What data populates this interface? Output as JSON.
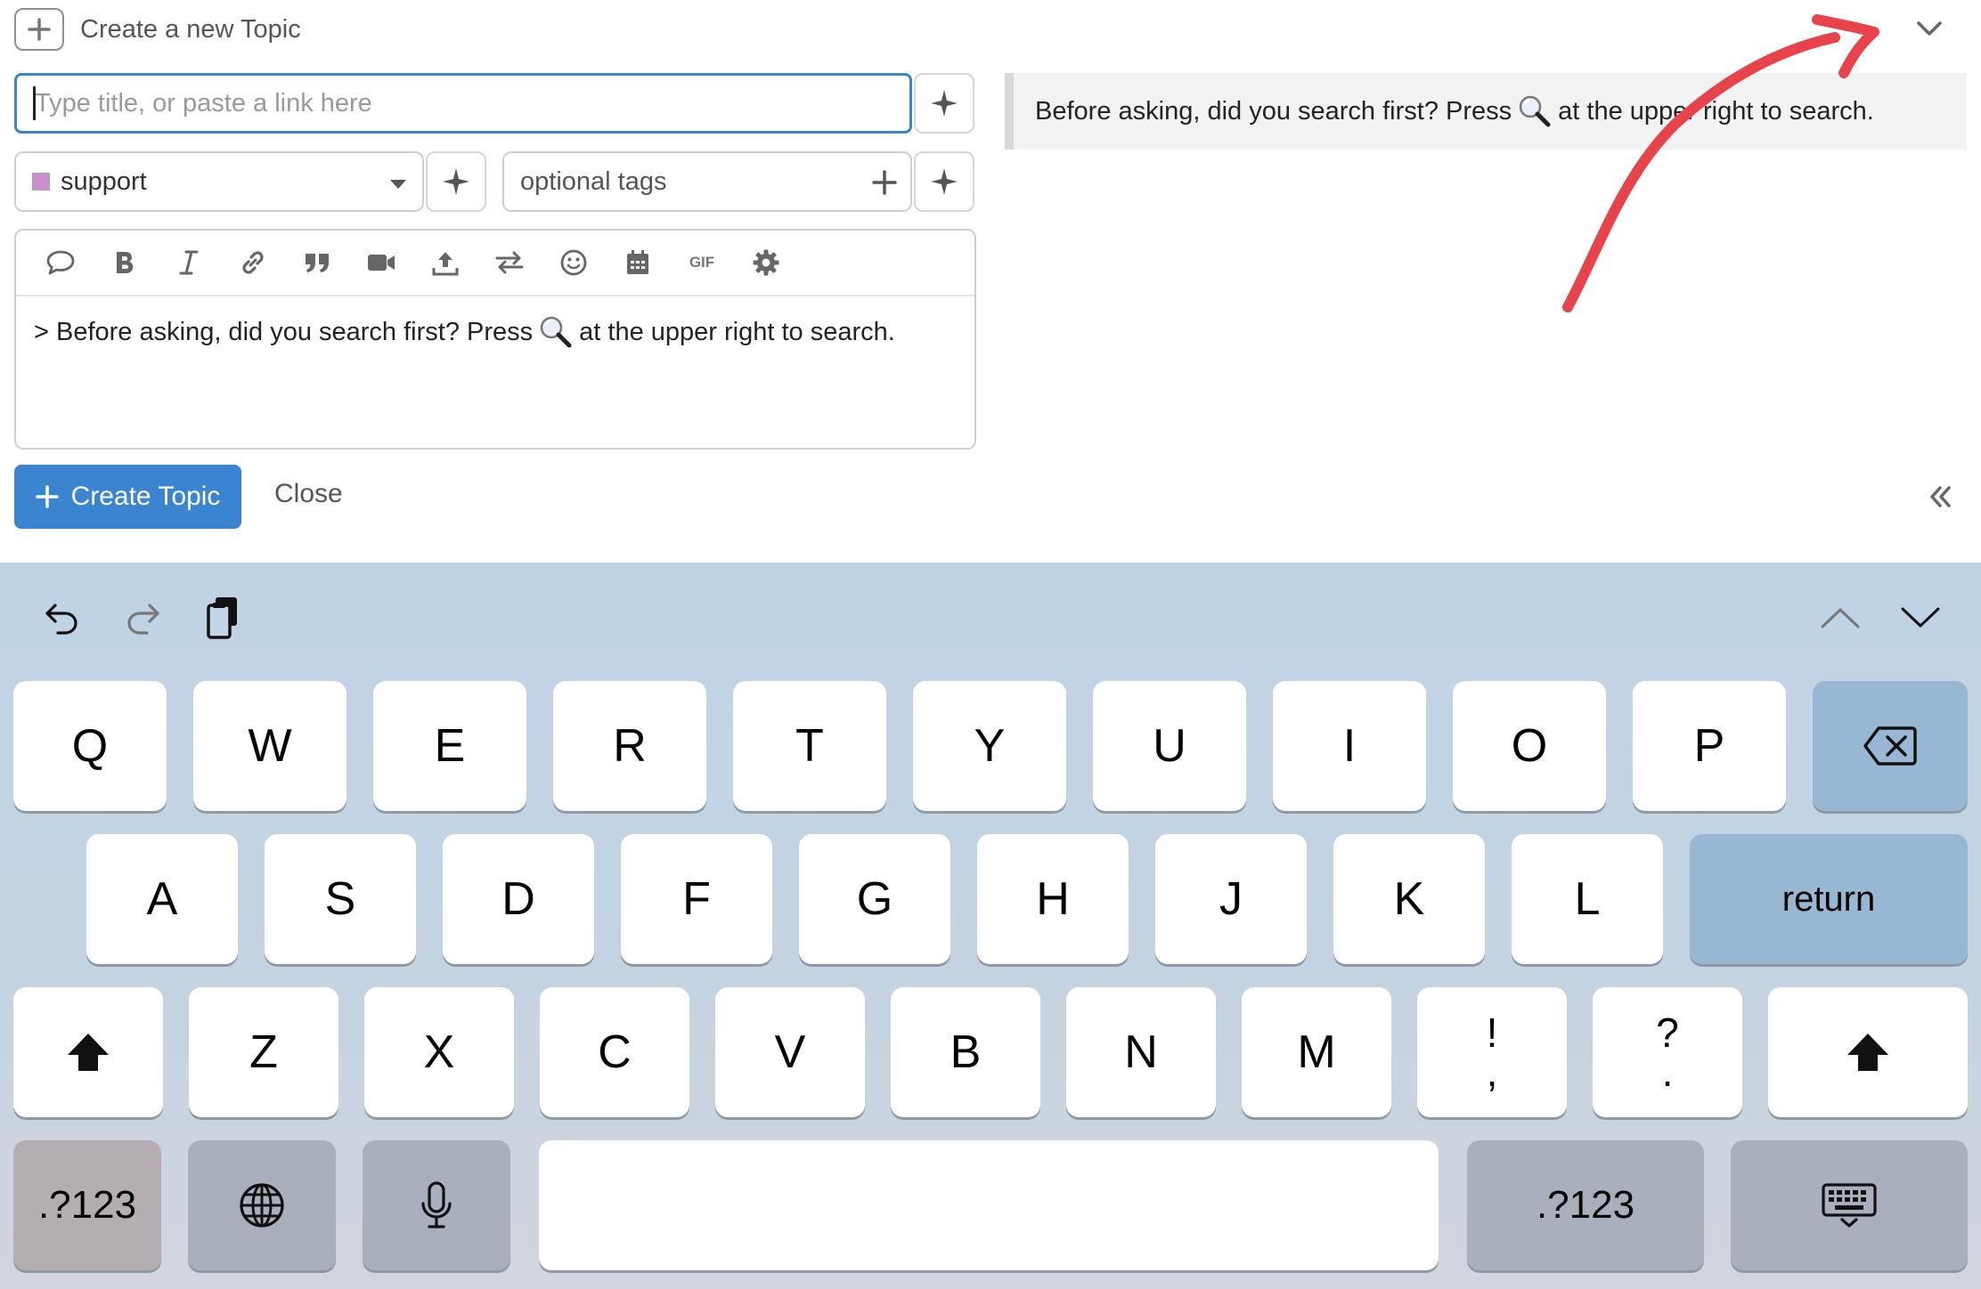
{
  "composer": {
    "header_title": "Create a new Topic",
    "title_placeholder": "Type title, or paste a link here",
    "category": "support",
    "category_color": "#c792c9",
    "tags_placeholder": "optional tags",
    "editor_text_before_icon": "> Before asking, did you search first? Press",
    "editor_text_after_icon": "at the upper right to search.",
    "preview_text_before_icon": "Before asking, did you search first? Press",
    "preview_text_after_icon": "at the upper right to search.",
    "create_button": "Create Topic",
    "close_button": "Close",
    "accent_color": "#3b84d0",
    "toolbar_icons": [
      "speech-bubble-icon",
      "bold-icon",
      "italic-icon",
      "link-icon",
      "quote-icon",
      "video-icon",
      "upload-icon",
      "swap-icon",
      "emoji-icon",
      "calendar-icon",
      "gif-icon",
      "gear-icon"
    ],
    "gif_label": "GIF"
  },
  "annotation_color": "#e8434b",
  "keyboard": {
    "row1": [
      "Q",
      "W",
      "E",
      "R",
      "T",
      "Y",
      "U",
      "I",
      "O",
      "P"
    ],
    "row2": [
      "A",
      "S",
      "D",
      "F",
      "G",
      "H",
      "J",
      "K",
      "L"
    ],
    "return_label": "return",
    "row3": [
      "Z",
      "X",
      "C",
      "V",
      "B",
      "N",
      "M"
    ],
    "punct1_top": "!",
    "punct1_bottom": ",",
    "punct2_top": "?",
    "punct2_bottom": ".",
    "numbers_label": ".?123"
  }
}
